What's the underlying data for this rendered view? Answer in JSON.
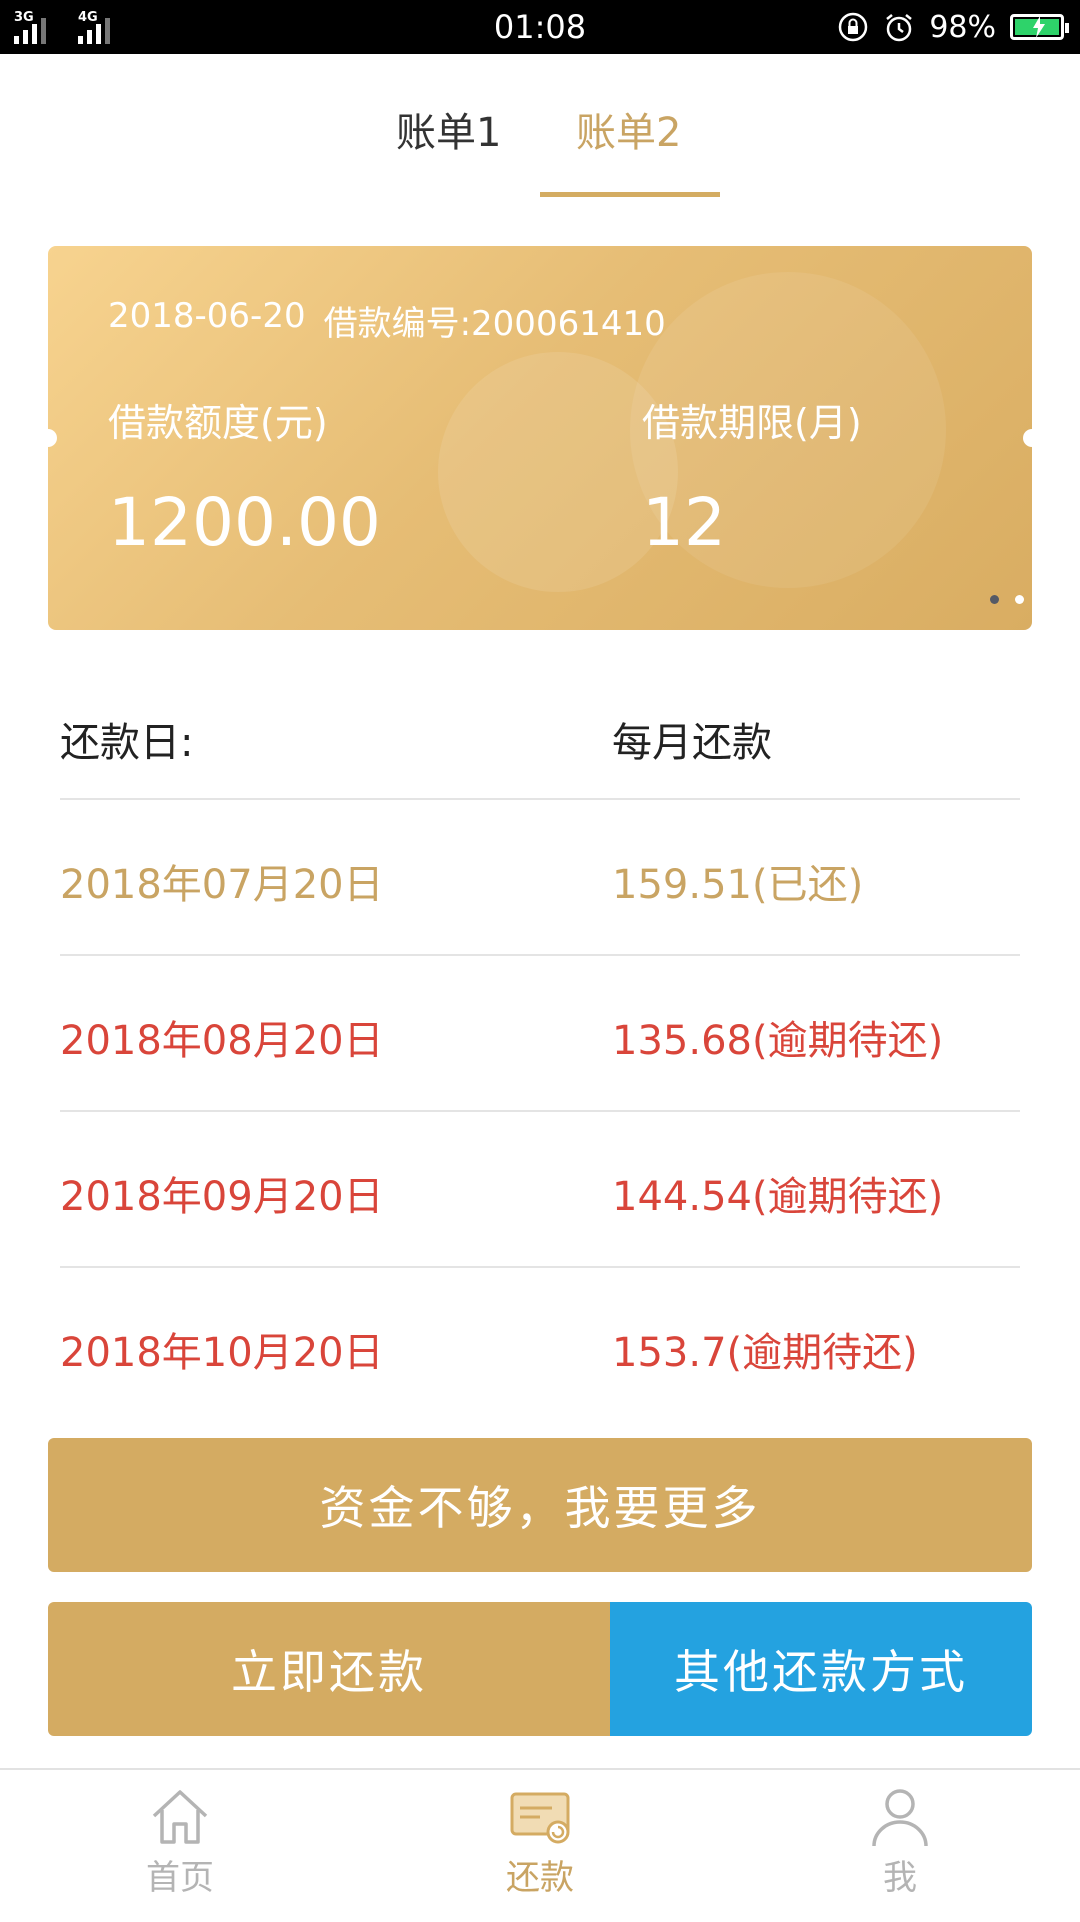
{
  "status_bar": {
    "network1": "3G",
    "network2": "4G",
    "time": "01:08",
    "battery": "98%"
  },
  "tabs": [
    {
      "label": "账单1",
      "active": false
    },
    {
      "label": "账单2",
      "active": true
    }
  ],
  "loan_card": {
    "date": "2018-06-20",
    "loan_number": "借款编号:200061410",
    "amount_label": "借款额度(元)",
    "amount_value": "1200.00",
    "term_label": "借款期限(月)",
    "term_value": "12",
    "page_count": 2,
    "active_page": 1
  },
  "schedule": {
    "header_date": "还款日:",
    "header_amount": "每月还款",
    "rows": [
      {
        "date": "2018年07月20日",
        "amount": "159.51(已还)",
        "status": "paid"
      },
      {
        "date": "2018年08月20日",
        "amount": "135.68(逾期待还)",
        "status": "overdue"
      },
      {
        "date": "2018年09月20日",
        "amount": "144.54(逾期待还)",
        "status": "overdue"
      },
      {
        "date": "2018年10月20日",
        "amount": "153.7(逾期待还)",
        "status": "overdue"
      }
    ]
  },
  "buttons": {
    "more_funds": "资金不够，我要更多",
    "repay_now": "立即还款",
    "other_methods": "其他还款方式"
  },
  "bottom_nav": [
    {
      "label": "首页",
      "icon": "home-icon",
      "active": false
    },
    {
      "label": "还款",
      "icon": "repayment-card-icon",
      "active": true
    },
    {
      "label": "我",
      "icon": "person-icon",
      "active": false
    }
  ],
  "colors": {
    "gold": "#d4ab62",
    "gold_text": "#c9a463",
    "overdue_red": "#d9453a",
    "blue": "#24a2e0"
  }
}
